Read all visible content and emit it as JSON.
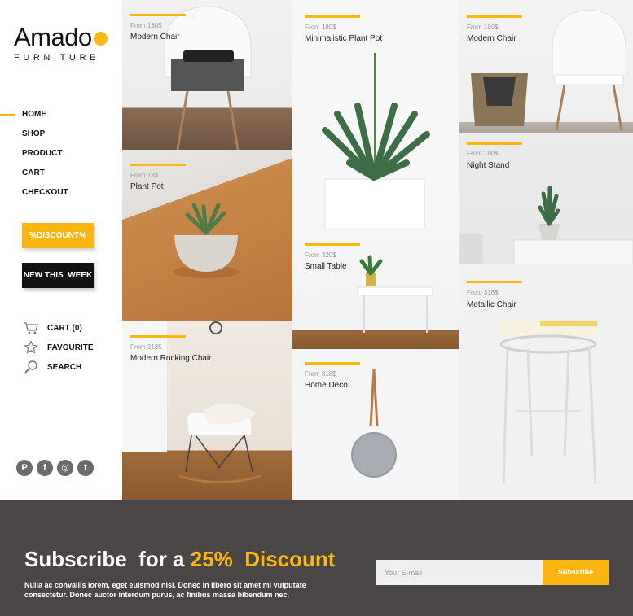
{
  "brand": {
    "name": "Amado",
    "subtitle": "FURNITURE",
    "accent": "#fbb710"
  },
  "nav": [
    {
      "label": "HOME",
      "active": true
    },
    {
      "label": "SHOP",
      "active": false
    },
    {
      "label": "PRODUCT",
      "active": false
    },
    {
      "label": "CART",
      "active": false
    },
    {
      "label": "CHECKOUT",
      "active": false
    }
  ],
  "buttons": {
    "discount": "%DISCOUNT%",
    "new_this_week": "NEW THIS  WEEK"
  },
  "quick_links": [
    {
      "label": "CART (0)",
      "icon": "cart-icon"
    },
    {
      "label": "FAVOURITE",
      "icon": "star-icon"
    },
    {
      "label": "SEARCH",
      "icon": "search-icon"
    }
  ],
  "social": [
    {
      "icon": "pinterest-icon",
      "glyph": "P"
    },
    {
      "icon": "facebook-icon",
      "glyph": "f"
    },
    {
      "icon": "instagram-icon",
      "glyph": "◎"
    },
    {
      "icon": "twitter-icon",
      "glyph": "t"
    }
  ],
  "products": [
    {
      "price": "From 180$",
      "name": "Modern Chair"
    },
    {
      "price": "From 18$",
      "name": "Plant Pot"
    },
    {
      "price": "From 318$",
      "name": "Modern Rocking Chair"
    },
    {
      "price": "From 180$",
      "name": "Minimalistic Plant Pot"
    },
    {
      "price": "From 320$",
      "name": "Small Table"
    },
    {
      "price": "From 318$",
      "name": "Home Deco"
    },
    {
      "price": "From 180$",
      "name": "Modern Chair"
    },
    {
      "price": "From 180$",
      "name": "Night Stand"
    },
    {
      "price": "From 318$",
      "name": "Metallic Chair"
    }
  ],
  "newsletter": {
    "title_prefix": "Subscribe  for a ",
    "title_accent": "25%  Discount",
    "text": "Nulla ac convallis lorem, eget euismod nisl. Donec in libero sit amet mi vulputate consectetur. Donec auctor interdum purus, ac finibus massa bibendum nec.",
    "email_placeholder": "Your E-mail",
    "button": "Subscribe"
  }
}
